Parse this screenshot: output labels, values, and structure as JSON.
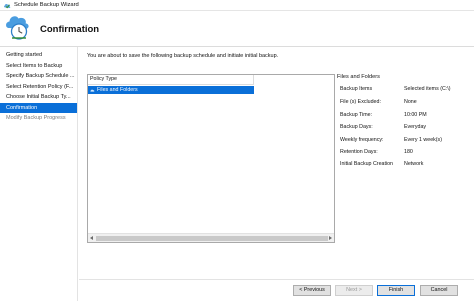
{
  "window": {
    "title": "Schedule Backup Wizard"
  },
  "header": {
    "title": "Confirmation"
  },
  "sidebar": {
    "items": [
      {
        "label": "Getting started"
      },
      {
        "label": "Select Items to Backup"
      },
      {
        "label": "Specify Backup Schedule ..."
      },
      {
        "label": "Select Retention Policy (F..."
      },
      {
        "label": "Choose Initial Backup Ty..."
      },
      {
        "label": "Confirmation"
      },
      {
        "label": "Modify Backup Progress"
      }
    ],
    "active_index": 5
  },
  "main": {
    "intro": "You are about to save the following backup schedule and initiate initial backup.",
    "list": {
      "column_header": "Policy Type",
      "selected_row": "Files and Folders"
    },
    "details": {
      "title": "Files and Folders",
      "rows": [
        {
          "key": "Backup Items",
          "value": "Selected items (C:\\)"
        },
        {
          "key": "File (s) Excluded:",
          "value": "None"
        },
        {
          "key": "Backup Time:",
          "value": "10:00 PM"
        },
        {
          "key": "Backup Days:",
          "value": "Everyday"
        },
        {
          "key": "Weekly frequency:",
          "value": "Every 1 week(s)"
        },
        {
          "key": "Retention Days:",
          "value": "180"
        },
        {
          "key": "Initial Backup Creation",
          "value": "Network"
        }
      ]
    }
  },
  "buttons": {
    "previous": "< Previous",
    "next": "Next >",
    "finish": "Finish",
    "cancel": "Cancel"
  },
  "colors": {
    "accent": "#0a6fd8",
    "window_bg": "#ffffff"
  }
}
